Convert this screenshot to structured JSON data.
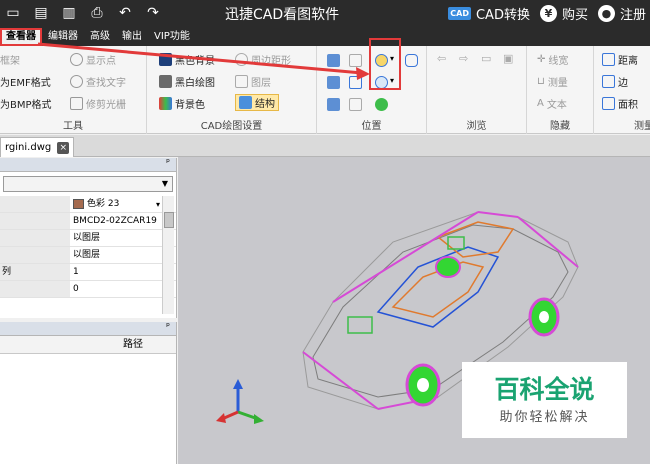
{
  "titlebar": {
    "title": "迅捷CAD看图软件",
    "cad_badge": "CAD",
    "cad_convert": "CAD转换",
    "buy": "购买",
    "register": "注册"
  },
  "menu": [
    "查看器",
    "编辑器",
    "高级",
    "输出",
    "VIP功能"
  ],
  "ribbon": {
    "tools": {
      "label": "工具",
      "items": [
        "框架",
        "为EMF格式",
        "为BMP格式",
        "显示点",
        "查找文字",
        "修剪光栅"
      ]
    },
    "settings": {
      "label": "CAD绘图设置",
      "items": [
        "黑色背景",
        "黑白绘图",
        "背景色",
        "图层",
        "结构",
        "周边距形"
      ]
    },
    "position": {
      "label": "位置"
    },
    "browse": {
      "label": "浏览"
    },
    "hide": {
      "label": "隐藏",
      "items": [
        "线宽",
        "测量",
        "文本"
      ]
    },
    "measure": {
      "label": "测量",
      "items": [
        "距离",
        "边",
        "面积"
      ]
    }
  },
  "doc_tab": {
    "filename": "rgini.dwg"
  },
  "properties": {
    "rows": [
      {
        "key": "",
        "value": "色彩 23"
      },
      {
        "key": "",
        "value": "BMCD2-02ZCAR19"
      },
      {
        "key": "",
        "value": "以图层"
      },
      {
        "key": "",
        "value": "以图层"
      },
      {
        "key": "列",
        "value": "1"
      },
      {
        "key": "",
        "value": "0"
      }
    ]
  },
  "files_panel": {
    "column": "路径"
  },
  "watermark": {
    "main": "百科全说",
    "sub": "助你轻松解决"
  },
  "colors": {
    "accent_red": "#e23a3a",
    "titlebar": "#2b2b2b",
    "canvas_bg": "#c8c8cc",
    "watermark_green": "#1aa371"
  }
}
